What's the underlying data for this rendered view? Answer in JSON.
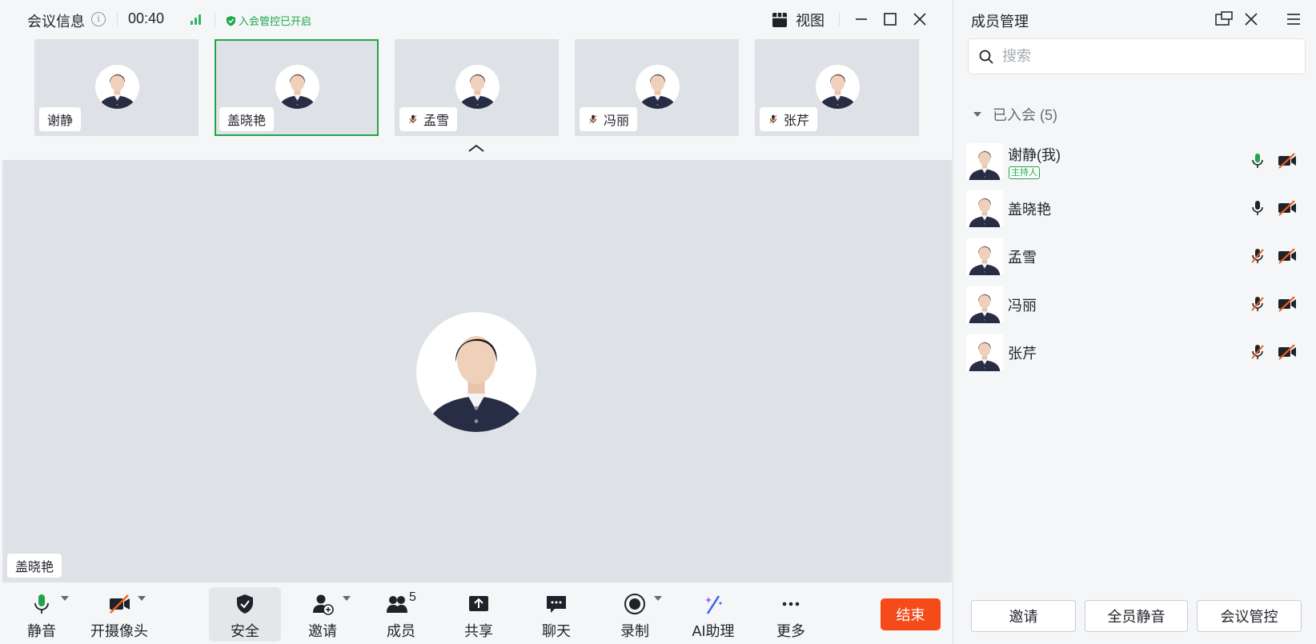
{
  "header": {
    "title": "会议信息",
    "timer": "00:40",
    "lock_status": "入会管控已开启",
    "view_label": "视图"
  },
  "thumbnails": [
    {
      "name": "谢静",
      "muted": false
    },
    {
      "name": "盖晓艳",
      "muted": false,
      "active": true
    },
    {
      "name": "孟雪",
      "muted": true
    },
    {
      "name": "冯丽",
      "muted": true
    },
    {
      "name": "张芹",
      "muted": true
    }
  ],
  "stage": {
    "speaker_name": "盖晓艳"
  },
  "toolbar": {
    "mute": "静音",
    "camera": "开摄像头",
    "security": "安全",
    "invite": "邀请",
    "members": "成员",
    "members_count": "5",
    "share": "共享",
    "chat": "聊天",
    "record": "录制",
    "ai": "AI助理",
    "more": "更多",
    "end": "结束"
  },
  "panel": {
    "title": "成员管理",
    "search_placeholder": "搜索",
    "group_label": "已入会 (5)",
    "host_badge": "主持人",
    "members": [
      {
        "name": "谢静(我)",
        "mic": "on-green",
        "cam": "off"
      },
      {
        "name": "盖晓艳",
        "mic": "on",
        "cam": "off"
      },
      {
        "name": "孟雪",
        "mic": "muted",
        "cam": "off"
      },
      {
        "name": "冯丽",
        "mic": "muted",
        "cam": "off"
      },
      {
        "name": "张芹",
        "mic": "muted",
        "cam": "off"
      }
    ],
    "buttons": {
      "invite": "邀请",
      "mute_all": "全员静音",
      "manage": "会议管控"
    }
  },
  "colors": {
    "accent_green": "#21a54a",
    "end_red": "#f54a1a",
    "muted_orange": "#f0601e"
  }
}
